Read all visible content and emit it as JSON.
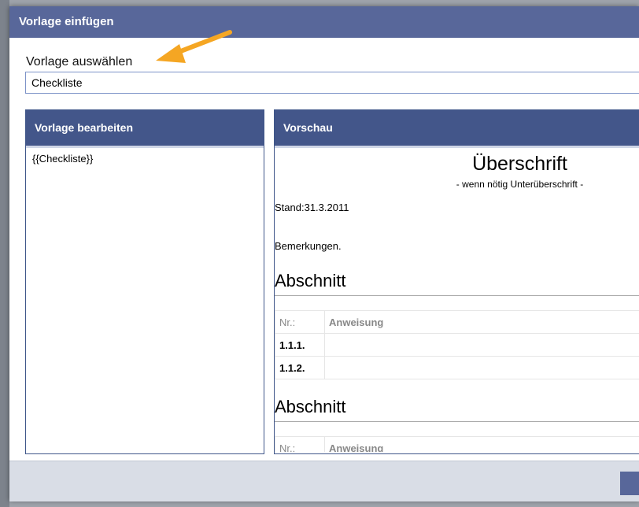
{
  "dialog": {
    "title": "Vorlage einfügen",
    "select_label": "Vorlage auswählen",
    "input_value": "Checkliste"
  },
  "edit_panel": {
    "header": "Vorlage bearbeiten",
    "content": "{{Checkliste}}"
  },
  "preview_panel": {
    "header": "Vorschau",
    "heading": "Überschrift",
    "subheading": "- wenn nötig Unterüberschrift -",
    "stand": "Stand:31.3.2011",
    "remarks": "Bemerkungen.",
    "sections": [
      {
        "title": "Abschnitt",
        "columns": [
          "Nr.:",
          "Anweisung"
        ],
        "rows": [
          {
            "nr": "1.1.1.",
            "instruction": ""
          },
          {
            "nr": "1.1.2.",
            "instruction": ""
          }
        ]
      },
      {
        "title": "Abschnitt",
        "columns": [
          "Nr.:",
          "Anweisung"
        ],
        "rows": []
      }
    ]
  },
  "colors": {
    "titlebar": "#58679a",
    "panel_header": "#43568a",
    "annotation_arrow": "#f5a623"
  },
  "icons": {
    "annotation": "arrow-annotation-icon"
  }
}
